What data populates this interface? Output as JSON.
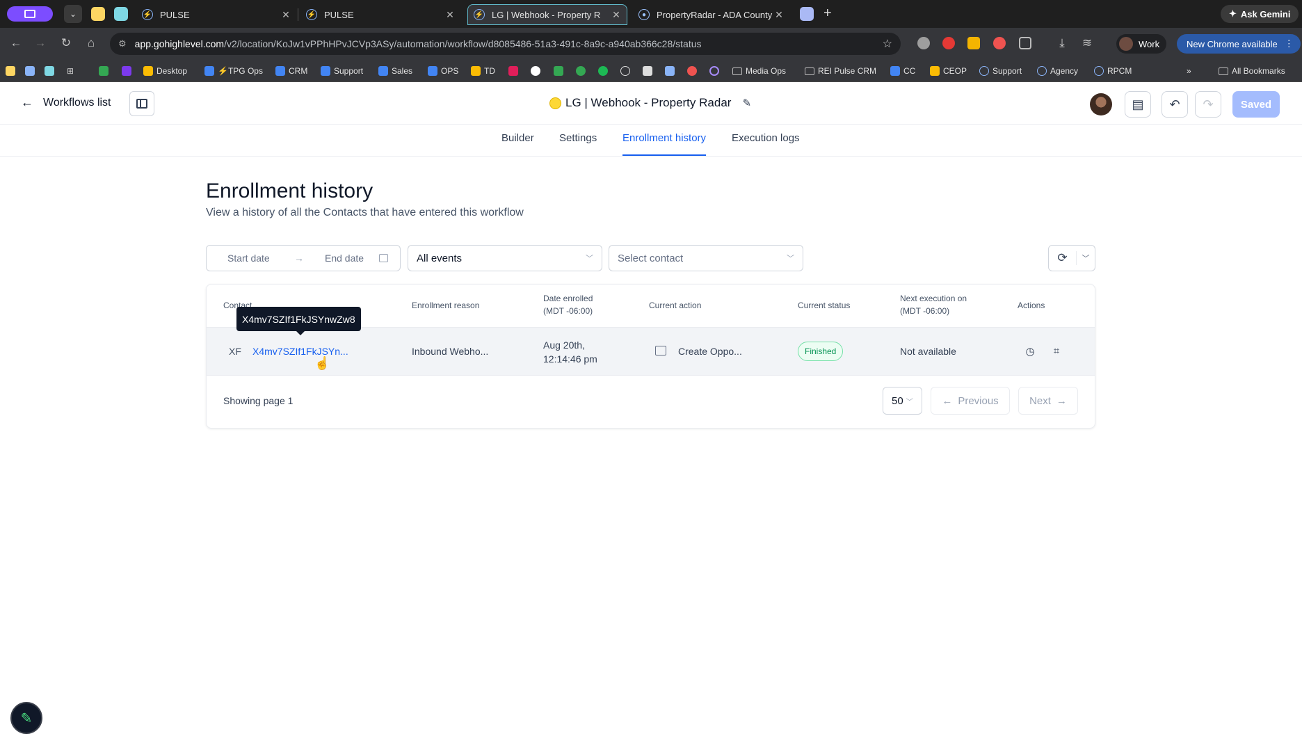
{
  "browser": {
    "tabs": [
      {
        "label": "PULSE",
        "active": false
      },
      {
        "label": "PULSE",
        "active": false
      },
      {
        "label": "LG | Webhook - Property R",
        "active": true
      },
      {
        "label": "PropertyRadar - ADA County",
        "active": false
      }
    ],
    "ask_gemini": "Ask Gemini",
    "url_host": "app.gohighlevel.com",
    "url_path": "/v2/location/KoJw1vPPhHPvJCVp3ASy/automation/workflow/d8085486-51a3-491c-8a9c-a940ab366c28/status",
    "profile_label": "Work",
    "update_label": "New Chrome available",
    "bookmarks": [
      "Desktop",
      "⚡TPG Ops",
      "CRM",
      "Support",
      "Sales",
      "OPS",
      "TD",
      "Media Ops",
      "REI Pulse CRM",
      "CC",
      "CEOP",
      "Support",
      "Agency",
      "RPCM"
    ],
    "all_bookmarks": "All Bookmarks"
  },
  "header": {
    "back_label": "Workflows list",
    "workflow_title": "LG | Webhook - Property Radar",
    "saved_label": "Saved"
  },
  "subtabs": [
    "Builder",
    "Settings",
    "Enrollment history",
    "Execution logs"
  ],
  "page": {
    "title": "Enrollment history",
    "subtitle": "View a history of all the Contacts that have entered this workflow"
  },
  "filters": {
    "start_date_placeholder": "Start date",
    "end_date_placeholder": "End date",
    "events_value": "All events",
    "contact_placeholder": "Select contact"
  },
  "table": {
    "headers": {
      "contact": "Contact",
      "reason": "Enrollment reason",
      "date_line1": "Date enrolled",
      "date_line2": "(MDT -06:00)",
      "action": "Current action",
      "status": "Current status",
      "next_line1": "Next execution on",
      "next_line2": "(MDT -06:00)",
      "actions": "Actions"
    },
    "rows": [
      {
        "initials": "XF",
        "contact": "X4mv7SZIf1FkJSYn...",
        "reason": "Inbound Webho...",
        "date_line1": "Aug 20th,",
        "date_line2": "12:14:46 pm",
        "action": "Create Oppo...",
        "status": "Finished",
        "next": "Not available"
      }
    ],
    "tooltip": "X4mv7SZIf1FkJSYnwZw8"
  },
  "pagination": {
    "showing": "Showing page 1",
    "page_size": "50",
    "previous": "Previous",
    "next": "Next"
  },
  "colors": {
    "accent": "#155eef",
    "status_success": "#079455",
    "saved_button": "#a4bcfd"
  }
}
